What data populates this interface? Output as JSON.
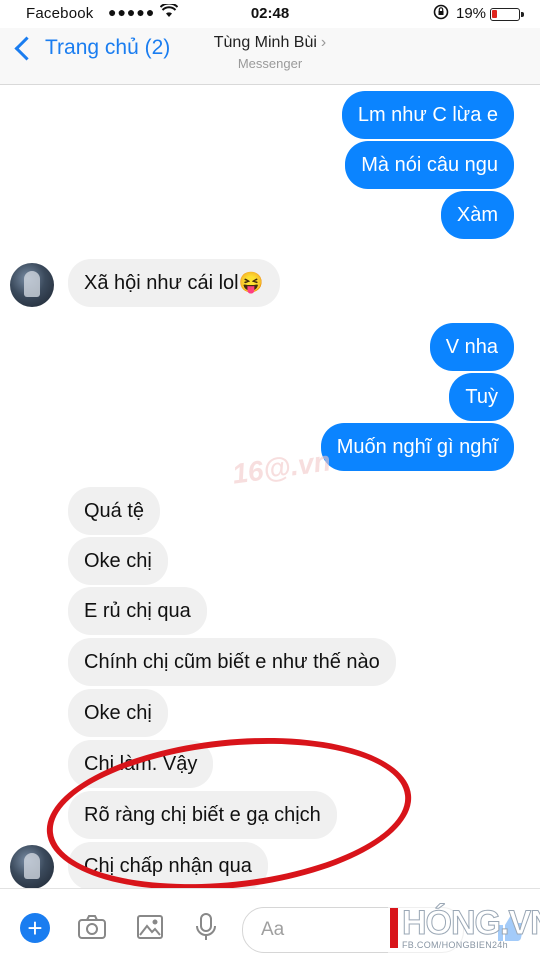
{
  "status_bar": {
    "carrier": "Facebook",
    "signal": "●●●●●",
    "time": "02:48",
    "battery_percent": "19%",
    "battery_level": 0.19
  },
  "header": {
    "back_label": "Trang chủ (2)",
    "contact_name": "Tùng Minh Bùi",
    "more_glyph": "›",
    "subtitle": "Messenger"
  },
  "messages": [
    {
      "from": "me",
      "text": "Lm như C lừa e"
    },
    {
      "from": "me",
      "text": "Mà nói câu ngu"
    },
    {
      "from": "me",
      "text": "Xàm"
    },
    {
      "from": "them",
      "text": "Xã hội như cái lol😝"
    },
    {
      "from": "me",
      "text": "V nha"
    },
    {
      "from": "me",
      "text": "Tuỳ"
    },
    {
      "from": "me",
      "text": "Muốn nghĩ gì nghĩ"
    },
    {
      "from": "them",
      "text": "Quá tệ"
    },
    {
      "from": "them",
      "text": "Oke chị"
    },
    {
      "from": "them",
      "text": "E rủ chị qua"
    },
    {
      "from": "them",
      "text": "Chính chị cũm biết e như thế nào"
    },
    {
      "from": "them",
      "text": "Oke chị"
    },
    {
      "from": "them",
      "text": "Chị làm. Vậy"
    },
    {
      "from": "them",
      "text": "Rõ ràng chị biết e gạ chịch"
    },
    {
      "from": "them",
      "text": "Chị chấp nhận qua"
    }
  ],
  "composer": {
    "placeholder": "Aa",
    "icons": [
      "plus-icon",
      "camera-icon",
      "gallery-icon",
      "microphone-icon",
      "like-icon"
    ]
  },
  "watermarks": {
    "center": "16@.vn",
    "brand": "HÓNG.VN",
    "brand_sub": "FB.COM/HONGBIEN24h"
  },
  "colors": {
    "outgoing_bubble": "#0b84ff",
    "incoming_bubble": "#f0f0f0",
    "accent": "#1a7df0",
    "annotation_circle": "#d8141a"
  }
}
